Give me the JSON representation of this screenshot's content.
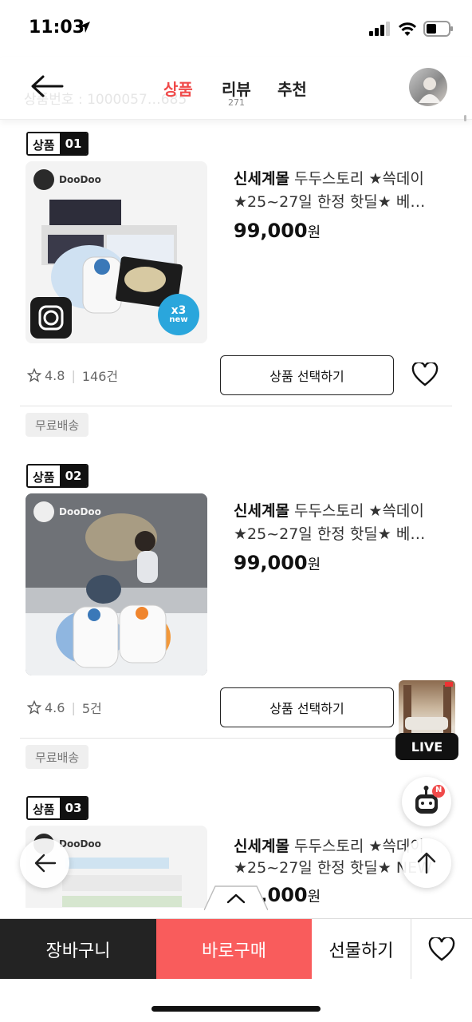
{
  "status_bar": {
    "time": "11:03"
  },
  "header": {
    "ghost_text": "상품번호 : 1000057…685",
    "tabs": [
      {
        "label": "상품",
        "active": true
      },
      {
        "label": "리뷰",
        "count": "271"
      },
      {
        "label": "추천"
      }
    ]
  },
  "colors": {
    "accent": "#f04a4a",
    "buy": "#f95c5c",
    "cart": "#232323"
  },
  "products": [
    {
      "badge_label": "상품",
      "badge_num": "01",
      "brand": "DooDoo",
      "seller": "신세계몰",
      "title_rest": "두두스토리 ★쓱데이",
      "title_line2": "★25~27일 한정 핫딜★ 베…",
      "price": "99,000",
      "price_unit": "원",
      "rating": "4.8",
      "reviews": "146건",
      "select_label": "상품 선택하기",
      "ship": "무료배송",
      "x3_badge": "x3",
      "x3_sub": "new"
    },
    {
      "badge_label": "상품",
      "badge_num": "02",
      "brand": "DooDoo",
      "seller": "신세계몰",
      "title_rest": "두두스토리 ★쓱데이",
      "title_line2": "★25~27일 한정 핫딜★ 베…",
      "price": "99,000",
      "price_unit": "원",
      "rating": "4.6",
      "reviews": "5건",
      "select_label": "상품 선택하기",
      "ship": "무료배송"
    },
    {
      "badge_label": "상품",
      "badge_num": "03",
      "brand": "DooDoo",
      "seller": "신세계몰",
      "title_rest": "두두스토리 ★쓱데이",
      "title_line2": "★25~27일 한정 핫딜★ NEW",
      "price": "99,000",
      "price_unit": "원"
    }
  ],
  "floating": {
    "live_label": "LIVE",
    "bot_badge": "N"
  },
  "bottom_bar": {
    "cart": "장바구니",
    "buy": "바로구매",
    "gift": "선물하기"
  }
}
